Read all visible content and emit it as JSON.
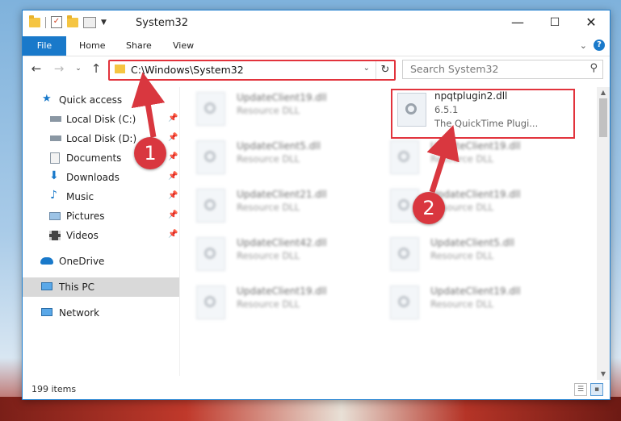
{
  "window": {
    "title": "System32"
  },
  "window_controls": {
    "minimize": "—",
    "maximize": "☐",
    "close": "✕"
  },
  "ribbon": {
    "tabs": [
      "File",
      "Home",
      "Share",
      "View"
    ]
  },
  "address_bar": {
    "path": "C:\\Windows\\System32"
  },
  "search": {
    "placeholder": "Search System32"
  },
  "sidebar": {
    "items": [
      {
        "label": "Quick access",
        "icon": "star-icon",
        "pinned": false
      },
      {
        "label": "Local Disk (C:)",
        "icon": "drive-icon",
        "pinned": true
      },
      {
        "label": "Local Disk (D:)",
        "icon": "drive-icon",
        "pinned": true
      },
      {
        "label": "Documents",
        "icon": "documents-icon",
        "pinned": true
      },
      {
        "label": "Downloads",
        "icon": "download-icon",
        "pinned": true
      },
      {
        "label": "Music",
        "icon": "music-icon",
        "pinned": true
      },
      {
        "label": "Pictures",
        "icon": "pictures-icon",
        "pinned": true
      },
      {
        "label": "Videos",
        "icon": "videos-icon",
        "pinned": true
      },
      {
        "label": "OneDrive",
        "icon": "cloud-icon",
        "pinned": false
      },
      {
        "label": "This PC",
        "icon": "computer-icon",
        "pinned": false,
        "selected": true
      },
      {
        "label": "Network",
        "icon": "network-icon",
        "pinned": false
      }
    ]
  },
  "files": {
    "highlighted": {
      "name": "npqtplugin2.dll",
      "version": "6.5.1",
      "description": "The QuickTime Plugi..."
    },
    "left_column": [
      {
        "name": "UpdateClient19.dll",
        "type": "Resource DLL"
      },
      {
        "name": "UpdateClient5.dll",
        "type": "Resource DLL"
      },
      {
        "name": "UpdateClient21.dll",
        "type": "Resource DLL"
      },
      {
        "name": "UpdateClient42.dll",
        "type": "Resource DLL"
      },
      {
        "name": "UpdateClient19.dll",
        "type": "Resource DLL"
      }
    ],
    "right_column": [
      {
        "name": "UpdateClient19.dll",
        "type": "Resource DLL"
      },
      {
        "name": "UpdateClient19.dll",
        "type": "Resource DLL"
      },
      {
        "name": "UpdateClient5.dll",
        "type": "Resource DLL"
      },
      {
        "name": "UpdateClient19.dll",
        "type": "Resource DLL"
      }
    ]
  },
  "status": {
    "item_count": "199 items"
  },
  "callouts": [
    "1",
    "2"
  ],
  "colors": {
    "accent": "#1979ca",
    "annotation_red": "#d9373f"
  }
}
